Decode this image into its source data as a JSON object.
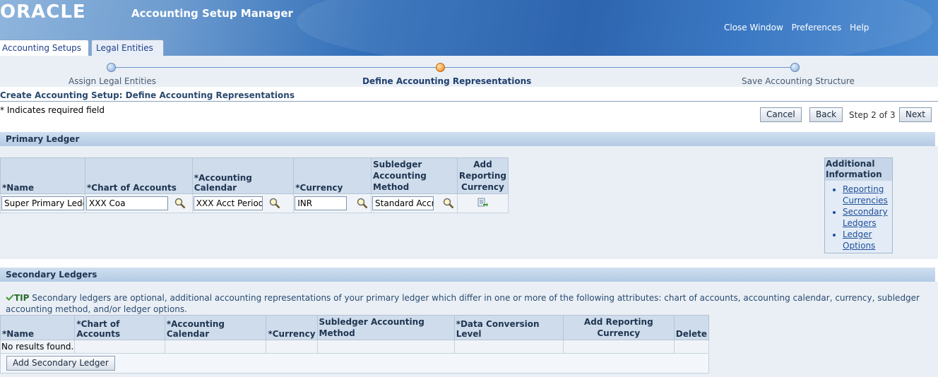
{
  "header": {
    "logo": "ORACLE",
    "app_title": "Accounting Setup Manager",
    "links": [
      "Close Window",
      "Preferences",
      "Help"
    ]
  },
  "tabs": [
    {
      "label": "Accounting Setups",
      "active": true
    },
    {
      "label": "Legal Entities",
      "active": false
    }
  ],
  "train": {
    "steps": [
      "Assign Legal Entities",
      "Define Accounting Representations",
      "Save Accounting Structure"
    ],
    "current": 1
  },
  "page": {
    "title": "Create Accounting Setup: Define Accounting Representations",
    "required_note": "* Indicates required field",
    "buttons": {
      "cancel": "Cancel",
      "back": "Back",
      "next": "Next"
    },
    "step_text": "Step 2 of 3"
  },
  "primary_ledger": {
    "section_title": "Primary Ledger",
    "headers": {
      "name": "*Name",
      "coa": "*Chart of Accounts",
      "calendar": "*Accounting Calendar",
      "currency": "*Currency",
      "sla_line1": "Subledger",
      "sla_line2": "Accounting",
      "sla_line3": "Method",
      "arc_line1": "Add",
      "arc_line2": "Reporting",
      "arc_line3": "Currency"
    },
    "row": {
      "name": "Super Primary Ledger",
      "coa": "XXX Coa",
      "calendar": "XXX Acct Period",
      "currency": "INR",
      "sla": "Standard Accrual"
    }
  },
  "additional_info": {
    "title": "Additional Information",
    "links": [
      {
        "line1": "Reporting",
        "line2": "Currencies"
      },
      {
        "line1": "Secondary",
        "line2": "Ledgers"
      },
      {
        "line1": "Ledger",
        "line2": "Options"
      }
    ]
  },
  "secondary_ledgers": {
    "section_title": "Secondary Ledgers",
    "tip_label": "TIP",
    "tip_text": "Secondary ledgers are optional, additional accounting representations of your primary ledger which differ in one or more of the following attributes: chart of accounts, accounting calendar, currency, subledger accounting method, and/or ledger options.",
    "headers": {
      "name": "*Name",
      "coa": "*Chart of Accounts",
      "calendar": "*Accounting Calendar",
      "currency": "*Currency",
      "sla_line1": "Subledger Accounting",
      "sla_line2": "Method",
      "dcl": "*Data Conversion Level",
      "arc_line1": "Add Reporting",
      "arc_line2": "Currency",
      "delete": "Delete"
    },
    "empty_text": "No results found.",
    "add_button": "Add Secondary Ledger"
  },
  "colors": {
    "accent": "#1f3f8a",
    "current_step": "#f3a44a"
  },
  "icons": [
    "search-icon",
    "add-reporting-currency-icon",
    "tip-check-icon"
  ]
}
